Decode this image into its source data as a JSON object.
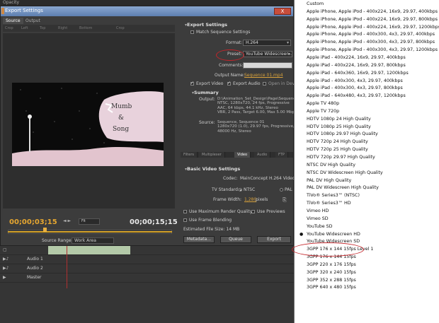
{
  "background_app": {
    "panel_title": "Opacity"
  },
  "dialog": {
    "title": "Export Settings",
    "close_glyph": "X",
    "left_tabs": [
      "Source",
      "Output"
    ],
    "toolbar": [
      "Crop",
      "Left",
      "Top",
      "Right",
      "Bottom",
      "Crop"
    ],
    "timecode_current": "00;00;03;15",
    "timecode_duration": "00;00;15;15",
    "fit_value": "Fit",
    "source_range_label": "Source Range:",
    "source_range_value": "Work Area"
  },
  "export_settings": {
    "section_title": "Export Settings",
    "match_sequence_label": "Match Sequence Settings",
    "format_label": "Format:",
    "format_value": "H.264",
    "preset_label": "Preset:",
    "preset_value": "YouTube Widescreen...",
    "comments_label": "Comments:",
    "output_name_label": "Output Name:",
    "output_name_value": "Sequence 01.mp4",
    "export_video_label": "Export Video",
    "export_audio_label": "Export Audio",
    "open_in_device_label": "Open in Dev",
    "summary_title": "Summary",
    "summary_output_label": "Output:",
    "summary_output_lines": [
      "D:\\Animation_Set_Design\\Page\\Sequence...",
      "NTSC, 1280x720, 24 fps, Progressive",
      "AAC, 64 kbps, 44.1 kHz, Stereo",
      "VBR, 2 Pass, Target 6.00, Max 5.00 Mbps"
    ],
    "summary_source_label": "Source:",
    "summary_source_lines": [
      "Sequence, Sequence 01",
      "1280x720 (1.0), 29.97 fps, Progressive, 00",
      "48000 Hz, Stereo"
    ]
  },
  "settings_tabs": [
    "Filters",
    "Multiplexer",
    "Video",
    "Audio",
    "FTP"
  ],
  "basic_video": {
    "section_title": "Basic Video Settings",
    "codec_label": "Codec:",
    "codec_value": "MainConcept H.264 Video",
    "tv_standard_label": "TV Standard:",
    "tv_ntsc": "NTSC",
    "tv_pal": "PAL",
    "frame_width_label": "Frame Width:",
    "frame_width_value": "1,280",
    "frame_width_unit": "pixels"
  },
  "options": {
    "max_render_quality": "Use Maximum Render Quality",
    "use_previews": "Use Previews",
    "frame_blending": "Use Frame Blending",
    "estimated_size": "Estimated File Size:  14 MB"
  },
  "buttons": {
    "metadata": "Metadata...",
    "queue": "Queue",
    "export": "Export"
  },
  "timeline_tracks": [
    "",
    "Audio 1",
    "Audio 2",
    "Master"
  ],
  "preset_dropdown": {
    "selected_index": 30,
    "items": [
      "Custom",
      "Apple iPhone, Apple iPod - 400x224, 16x9, 29.97, 400kbps",
      "Apple iPhone, Apple iPod - 400x224, 16x9, 29.97, 800kbps",
      "Apple iPhone, Apple iPod - 400x224, 16x9, 29.97, 1200kbps",
      "Apple iPhone, Apple iPod - 400x300, 4x3, 29.97, 400kbps",
      "Apple iPhone, Apple iPod - 400x300, 4x3, 29.97, 800kbps",
      "Apple iPhone, Apple iPod - 400x300, 4x3, 29.97, 1200kbps",
      "Apple iPad - 400x224, 16x9, 29.97, 400kbps",
      "Apple iPad - 400x224, 16x9, 29.97, 800kbps",
      "Apple iPad - 640x360, 16x9, 29.97, 1200kbps",
      "Apple iPad - 400x300, 4x3, 29.97, 400kbps",
      "Apple iPad - 400x300, 4x3, 29.97, 800kbps",
      "Apple iPad - 640x480, 4x3, 29.97, 1200kbps",
      "Apple TV 480p",
      "Apple TV 720p",
      "HDTV 1080p 24 High Quality",
      "HDTV 1080p 25 High Quality",
      "HDTV 1080p 29.97 High Quality",
      "HDTV 720p 24 High Quality",
      "HDTV 720p 25 High Quality",
      "HDTV 720p 29.97 High Quality",
      "NTSC DV High Quality",
      "NTSC DV Widescreen High Quality",
      "PAL DV High Quality",
      "PAL DV Widescreen High Quality",
      "TiVo® Series3™ (NTSC)",
      "TiVo® Series3™ HD",
      "Vimeo HD",
      "Vimeo SD",
      "YouTube SD",
      "YouTube Widescreen HD",
      "YouTube Widescreen SD",
      "3GPP 176 x 144 15fps Level 1",
      "3GPP 176 x 144 15fps",
      "3GPP 220 x 176 15fps",
      "3GPP 320 x 240 15fps",
      "3GPP 352 x 288 15fps",
      "3GPP 640 x 480 15fps"
    ]
  },
  "colors": {
    "timecode_accent": "#e5a630",
    "annotation_red": "#c4252a",
    "link": "#d9a23b"
  }
}
